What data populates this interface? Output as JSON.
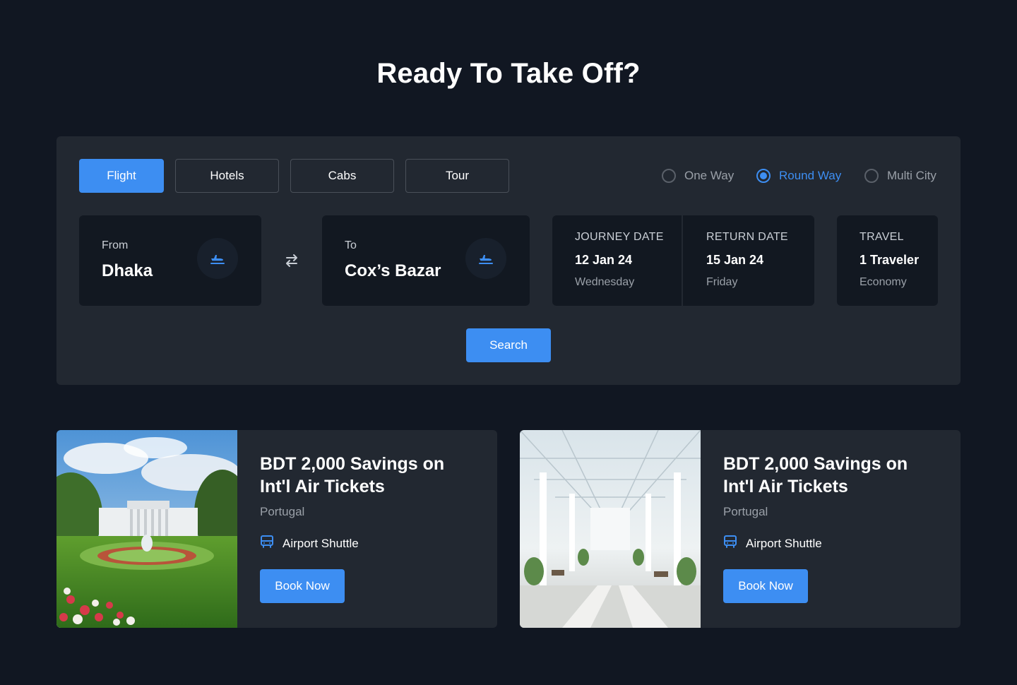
{
  "header": {
    "title": "Ready To Take Off?"
  },
  "tabs": [
    {
      "label": "Flight",
      "active": true
    },
    {
      "label": "Hotels",
      "active": false
    },
    {
      "label": "Cabs",
      "active": false
    },
    {
      "label": "Tour",
      "active": false
    }
  ],
  "trip_types": [
    {
      "label": "One Way",
      "selected": false
    },
    {
      "label": "Round Way",
      "selected": true
    },
    {
      "label": "Multi City",
      "selected": false
    }
  ],
  "from": {
    "label": "From",
    "value": "Dhaka",
    "icon": "airplane-departure-icon"
  },
  "to": {
    "label": "To",
    "value": "Cox’s Bazar",
    "icon": "airplane-departure-icon"
  },
  "swap_icon": "swap-arrows-icon",
  "journey": {
    "label": "JOURNEY DATE",
    "date": "12 Jan 24",
    "day": "Wednesday"
  },
  "return": {
    "label": "RETURN DATE",
    "date": "15 Jan 24",
    "day": "Friday"
  },
  "travel": {
    "label": "TRAVEL",
    "travelers": "1 Traveler",
    "class": "Economy"
  },
  "search_label": "Search",
  "offers": [
    {
      "image": "white-house-garden-photo",
      "title": "BDT 2,000 Savings on Int'l Air Tickets",
      "location": "Portugal",
      "amenity_icon": "bus-icon",
      "amenity": "Airport Shuttle",
      "button": "Book Now"
    },
    {
      "image": "airport-terminal-interior-photo",
      "title": "BDT 2,000 Savings on Int'l Air Tickets",
      "location": "Portugal",
      "amenity_icon": "bus-icon",
      "amenity": "Airport Shuttle",
      "button": "Book Now"
    }
  ],
  "colors": {
    "background": "#111722",
    "panel": "#222831",
    "card": "#121821",
    "accent": "#3d8ef2"
  }
}
